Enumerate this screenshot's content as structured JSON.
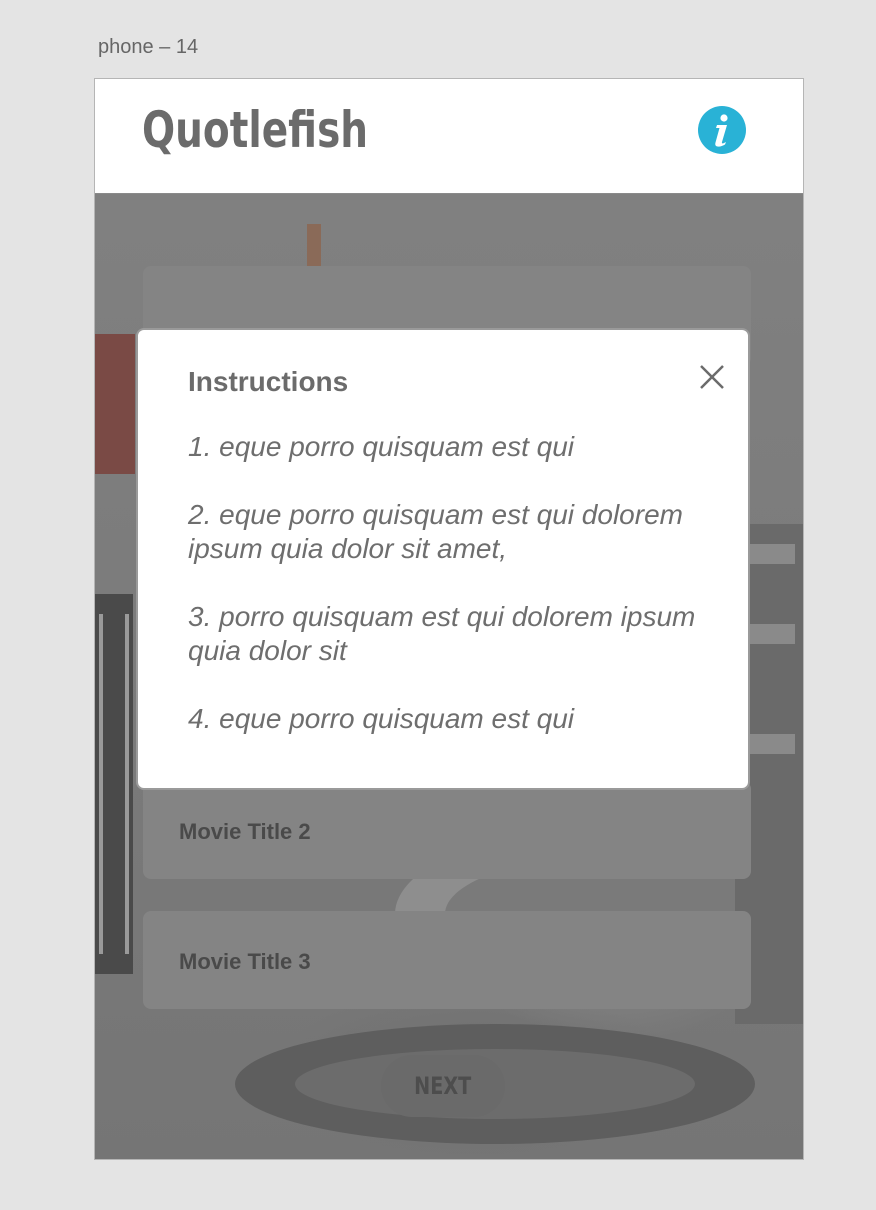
{
  "artboard": {
    "label": "phone – 14"
  },
  "header": {
    "app_title": "Quotlefish",
    "info_icon": "info-icon",
    "accent_color": "#29b2d6"
  },
  "modal": {
    "title": "Instructions",
    "close_icon": "close-icon",
    "instructions": [
      "1. eque porro quisquam est qui",
      "2. eque porro quisquam est qui dolorem ipsum quia dolor sit amet,",
      "3. porro quisquam est qui dolorem ipsum quia dolor sit",
      "4. eque porro quisquam est qui"
    ]
  },
  "movies": [
    {
      "title": ""
    },
    {
      "title": "Movie Title 2"
    },
    {
      "title": "Movie Title 3"
    }
  ],
  "next_button": {
    "label": "NEXT"
  }
}
